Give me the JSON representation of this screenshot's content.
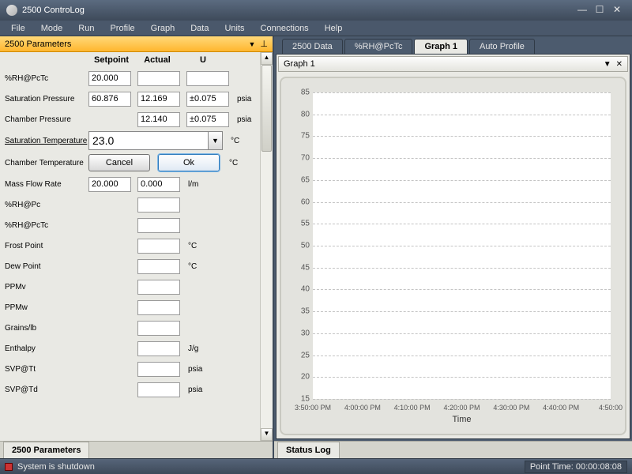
{
  "title": "2500 ControLog",
  "menu": [
    "File",
    "Mode",
    "Run",
    "Profile",
    "Graph",
    "Data",
    "Units",
    "Connections",
    "Help"
  ],
  "panel_header": "2500 Parameters",
  "col_heads": {
    "sp": "Setpoint",
    "actual": "Actual",
    "u": "U"
  },
  "rows": [
    {
      "label": "%RH@PcTc",
      "sp": "20.000",
      "actual": "",
      "u": "",
      "unit": ""
    },
    {
      "label": "Saturation Pressure",
      "sp": "60.876",
      "actual": "12.169",
      "u": "±0.075",
      "unit": "psia"
    },
    {
      "label": "Chamber Pressure",
      "sp": null,
      "actual": "12.140",
      "u": "±0.075",
      "unit": "psia"
    }
  ],
  "edit": {
    "label": "Saturation Temperature",
    "value": "23.0",
    "unit": "°C"
  },
  "btnrow": {
    "label": "Chamber Temperature",
    "cancel": "Cancel",
    "ok": "Ok",
    "unit": "°C"
  },
  "massflow": {
    "label": "Mass Flow Rate",
    "sp": "20.000",
    "actual": "0.000",
    "unit": "l/m"
  },
  "lower": [
    {
      "label": "%RH@Pc",
      "unit": ""
    },
    {
      "label": "%RH@PcTc",
      "unit": ""
    },
    {
      "label": "Frost Point",
      "unit": "°C"
    },
    {
      "label": "Dew Point",
      "unit": "°C"
    },
    {
      "label": "PPMv",
      "unit": ""
    },
    {
      "label": "PPMw",
      "unit": ""
    },
    {
      "label": "Grains/lb",
      "unit": ""
    },
    {
      "label": "Enthalpy",
      "unit": "J/g"
    },
    {
      "label": "SVP@Tt",
      "unit": "psia"
    },
    {
      "label": "SVP@Td",
      "unit": "psia"
    }
  ],
  "bottom_tab": "2500 Parameters",
  "tabs": [
    "2500 Data",
    "%RH@PcTc",
    "Graph 1",
    "Auto Profile"
  ],
  "active_tab": 2,
  "graph_header": "Graph 1",
  "status_tab": "Status Log",
  "status_text": "System is shutdown",
  "point_time": "Point Time: 00:00:08:08",
  "chart_data": {
    "type": "line",
    "title": "",
    "xlabel": "Time",
    "ylabel": "",
    "ylim": [
      15,
      85
    ],
    "yticks": [
      15,
      20,
      25,
      30,
      35,
      40,
      45,
      50,
      55,
      60,
      65,
      70,
      75,
      80,
      85
    ],
    "xticks": [
      "3:50:00 PM",
      "4:00:00 PM",
      "4:10:00 PM",
      "4:20:00 PM",
      "4:30:00 PM",
      "4:40:00 PM",
      "4:50:00"
    ],
    "series": []
  }
}
